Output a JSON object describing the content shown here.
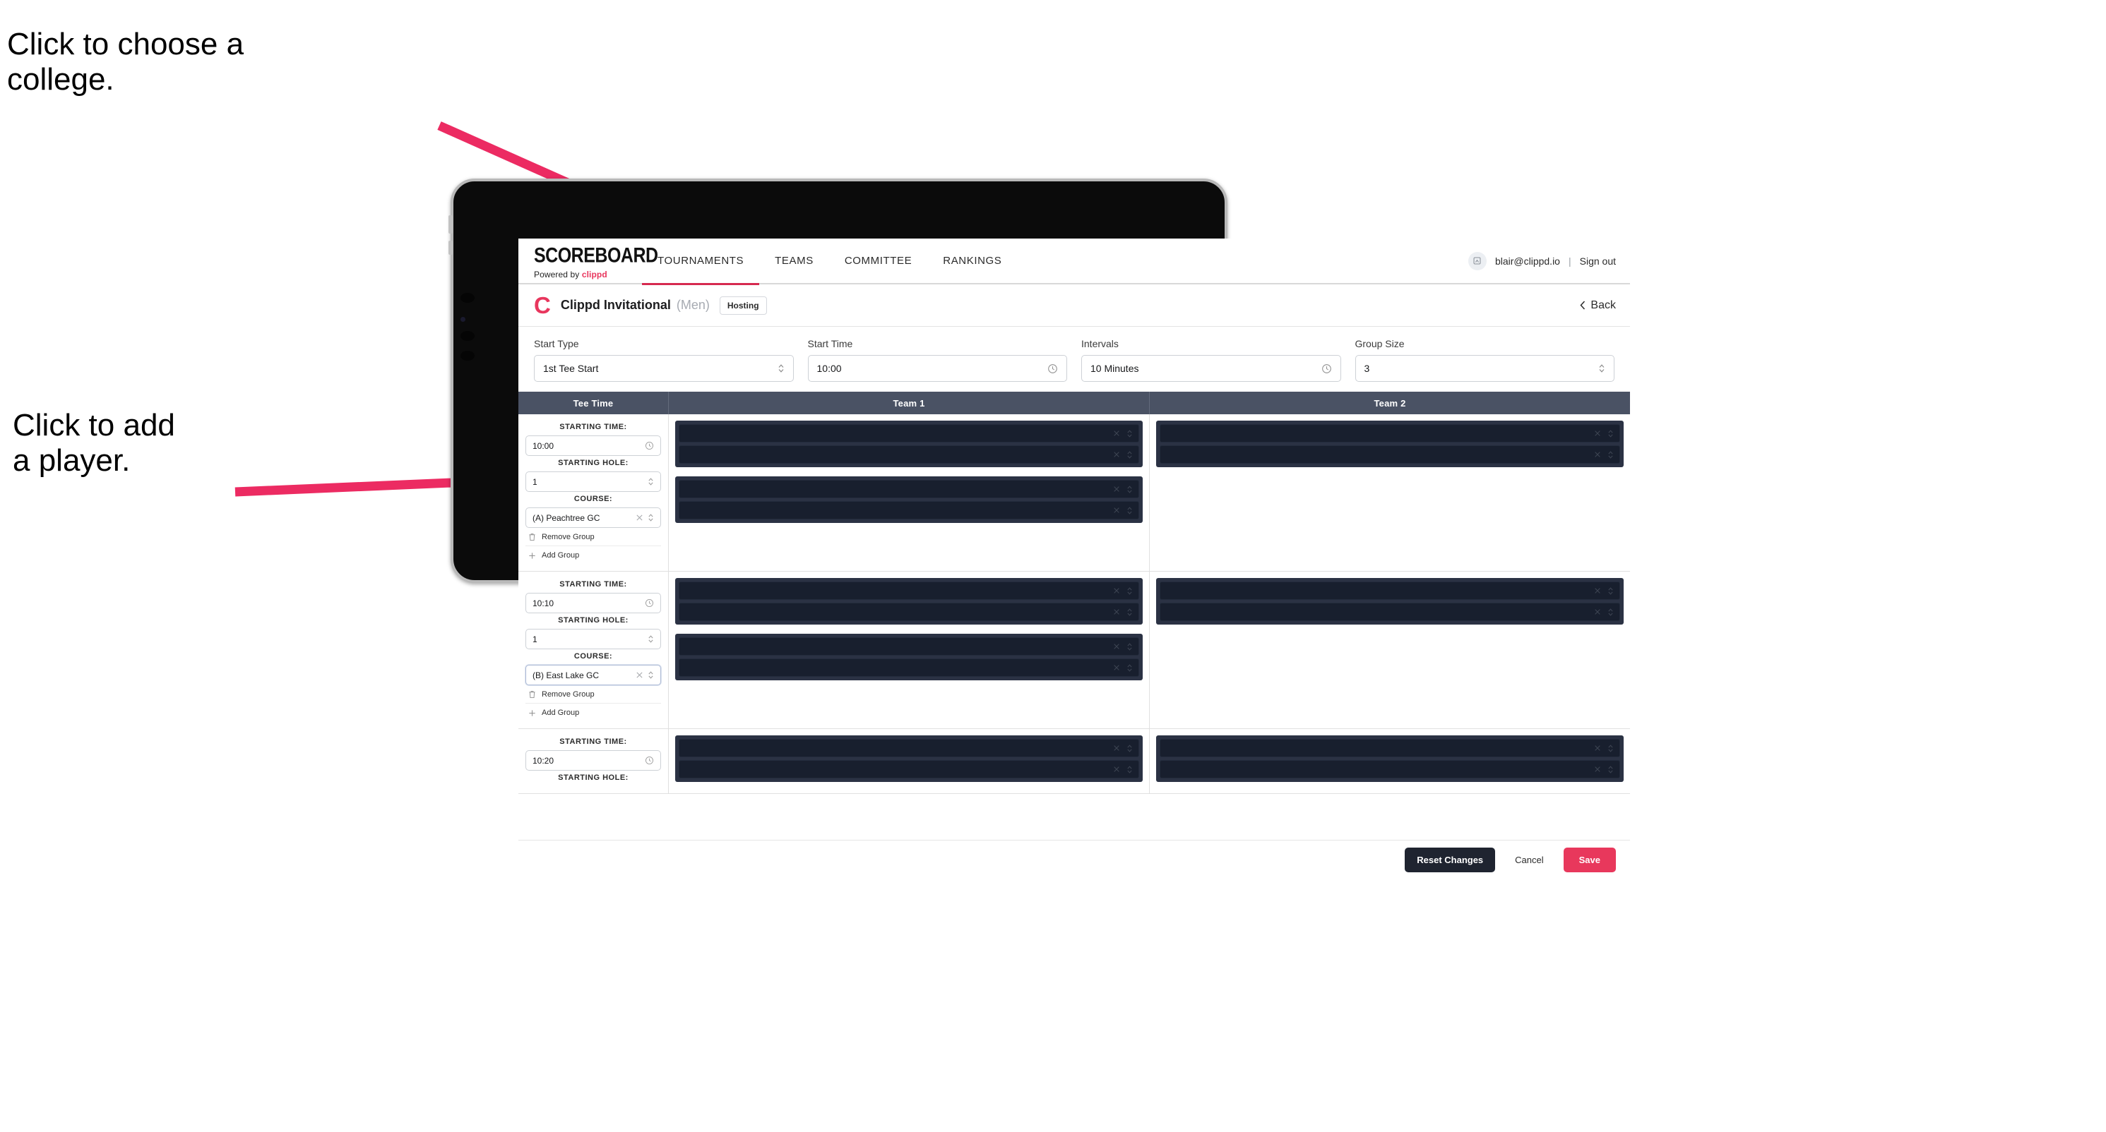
{
  "annotations": [
    {
      "id": "college",
      "text": "Click to choose a\ncollege."
    },
    {
      "id": "player",
      "text": "Click to add\na player."
    }
  ],
  "colors": {
    "accent_pink": "#e8365d",
    "nav_underline": "#d6294f",
    "table_header_bg": "#4a5264",
    "player_block_bg": "#2b3244",
    "player_row_bg": "#181f2e",
    "save_button": "#e8385c",
    "reset_button": "#1f2430"
  },
  "topnav": {
    "brand_word": "SCOREBOARD",
    "brand_powered_prefix": "Powered by",
    "brand_powered_name": "clippd",
    "links": [
      {
        "label": "TOURNAMENTS",
        "active": true
      },
      {
        "label": "TEAMS",
        "active": false
      },
      {
        "label": "COMMITTEE",
        "active": false
      },
      {
        "label": "RANKINGS",
        "active": false
      }
    ],
    "account": {
      "avatar_icon": "user-avatar-icon",
      "email": "blair@clippd.io",
      "separator": "|",
      "signout_label": "Sign out"
    }
  },
  "breadcrumb": {
    "logo_letter": "C",
    "title": "Clippd Invitational",
    "gender": "(Men)",
    "status_pill": "Hosting",
    "back_label": "Back",
    "back_icon": "chevron-left-icon"
  },
  "controls": [
    {
      "label": "Start Type",
      "value": "1st Tee Start",
      "icon": "chevron-updown-icon"
    },
    {
      "label": "Start Time",
      "value": "10:00",
      "icon": "clock-icon"
    },
    {
      "label": "Intervals",
      "value": "10 Minutes",
      "icon": "clock-icon"
    },
    {
      "label": "Group Size",
      "value": "3",
      "icon": "chevron-updown-icon"
    }
  ],
  "table": {
    "columns": [
      "Tee Time",
      "Team 1",
      "Team 2"
    ],
    "field_labels": {
      "starting_time": "STARTING TIME:",
      "starting_hole": "STARTING HOLE:",
      "course": "COURSE:"
    },
    "group_actions": {
      "remove": "Remove Group",
      "add": "Add Group",
      "remove_icon": "trash-icon",
      "add_icon": "plus-icon"
    },
    "player_row_icons": {
      "clear": "x-close-icon",
      "select": "chevron-updown-icon"
    },
    "rows": [
      {
        "starting_time": "10:00",
        "starting_hole": "1",
        "course": "(A) Peachtree GC",
        "course_focused": false,
        "team1_blocks": [
          {
            "players": [
              "",
              ""
            ]
          },
          {
            "players": [
              "",
              ""
            ]
          }
        ],
        "team2_blocks": [
          {
            "players": [
              "",
              ""
            ]
          }
        ]
      },
      {
        "starting_time": "10:10",
        "starting_hole": "1",
        "course": "(B) East Lake GC",
        "course_focused": true,
        "team1_blocks": [
          {
            "players": [
              "",
              ""
            ]
          },
          {
            "players": [
              "",
              ""
            ]
          }
        ],
        "team2_blocks": [
          {
            "players": [
              "",
              ""
            ]
          }
        ]
      },
      {
        "starting_time": "10:20",
        "starting_hole": "",
        "course": "",
        "course_focused": false,
        "team1_blocks": [
          {
            "players": [
              "",
              ""
            ]
          }
        ],
        "team2_blocks": [
          {
            "players": [
              "",
              ""
            ]
          }
        ]
      }
    ]
  },
  "footer": {
    "reset_label": "Reset Changes",
    "cancel_label": "Cancel",
    "save_label": "Save"
  }
}
